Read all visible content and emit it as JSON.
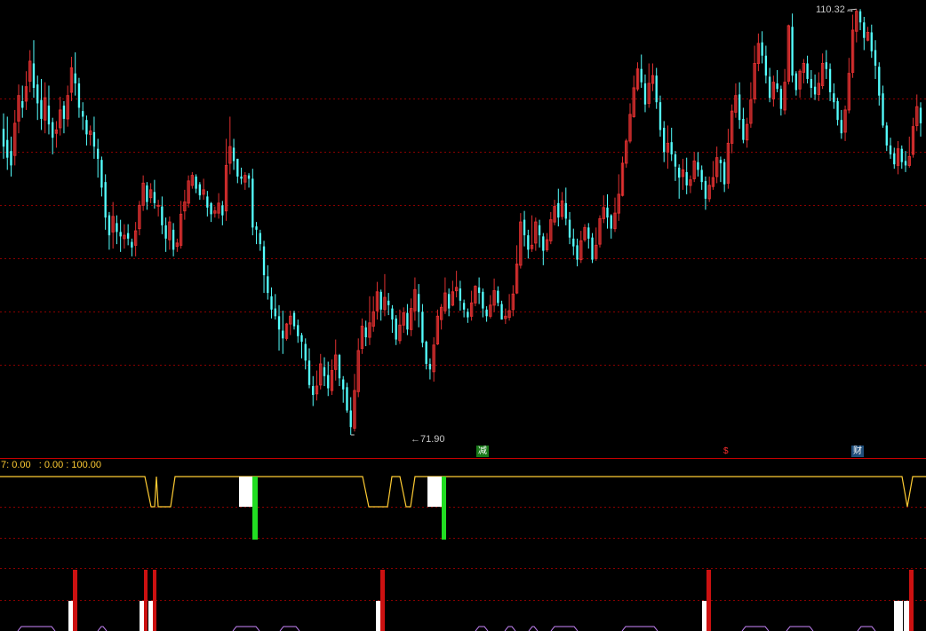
{
  "price_panel": {
    "high_label": "110.32",
    "low_label": "71.90",
    "price_min": 71.9,
    "price_max": 110.32,
    "gridline_prices": [
      102.2,
      97.4,
      92.6,
      87.8,
      83.0,
      78.2
    ],
    "up_color": "#e03030",
    "down_color": "#54ffff",
    "grid_color": "#8b0000",
    "candles": [
      [
        99.5,
        97.9,
        96.8,
        100.9
      ],
      [
        98.5,
        96.9,
        95.8,
        100.6
      ],
      [
        97.5,
        96.2,
        95.2,
        98.8
      ],
      [
        97.1,
        100.0,
        96.2,
        101.2
      ],
      [
        100.2,
        102.5,
        99.1,
        103.5
      ],
      [
        102.0,
        101.4,
        100.5,
        103.4
      ],
      [
        102.0,
        103.3,
        101.2,
        104.7
      ],
      [
        103.8,
        105.6,
        102.8,
        106.6
      ],
      [
        105.4,
        103.2,
        102.3,
        107.5
      ],
      [
        103.5,
        101.8,
        100.3,
        104.3
      ],
      [
        102.1,
        100.4,
        99.4,
        104.0
      ],
      [
        100.3,
        102.3,
        99.1,
        103.7
      ],
      [
        101.6,
        99.9,
        99.0,
        103.4
      ],
      [
        100.1,
        98.7,
        97.2,
        100.5
      ],
      [
        99.1,
        99.4,
        97.8,
        100.2
      ],
      [
        99.6,
        101.2,
        98.9,
        102.4
      ],
      [
        101.6,
        100.4,
        99.1,
        102.0
      ],
      [
        100.4,
        102.5,
        99.7,
        103.4
      ],
      [
        102.8,
        105.0,
        102.0,
        106.0
      ],
      [
        104.5,
        103.6,
        102.5,
        106.4
      ],
      [
        103.6,
        101.4,
        100.5,
        104.1
      ],
      [
        101.1,
        100.6,
        99.4,
        101.9
      ],
      [
        100.3,
        99.0,
        98.0,
        100.7
      ],
      [
        99.0,
        99.3,
        98.0,
        99.8
      ],
      [
        99.2,
        97.9,
        96.8,
        100.6
      ],
      [
        97.7,
        96.8,
        95.1,
        98.6
      ],
      [
        96.7,
        94.2,
        93.4,
        97.0
      ],
      [
        94.7,
        91.5,
        90.4,
        95.4
      ],
      [
        91.7,
        89.9,
        88.6,
        92.0
      ],
      [
        90.2,
        91.6,
        88.7,
        92.9
      ],
      [
        91.0,
        90.2,
        89.1,
        91.7
      ],
      [
        90.2,
        89.8,
        88.4,
        91.3
      ],
      [
        89.6,
        89.9,
        88.7,
        90.9
      ],
      [
        90.1,
        89.6,
        89.0,
        90.9
      ],
      [
        89.3,
        88.8,
        88.0,
        89.6
      ],
      [
        89.0,
        90.3,
        88.0,
        91.1
      ],
      [
        90.5,
        92.6,
        89.9,
        93.0
      ],
      [
        92.6,
        94.6,
        92.1,
        95.3
      ],
      [
        94.4,
        92.9,
        92.2,
        94.7
      ],
      [
        93.3,
        94.0,
        92.8,
        94.6
      ],
      [
        93.8,
        92.8,
        92.3,
        94.9
      ],
      [
        92.6,
        92.6,
        91.6,
        93.1
      ],
      [
        92.5,
        90.8,
        90.0,
        93.4
      ],
      [
        90.8,
        89.6,
        88.4,
        91.5
      ],
      [
        89.5,
        91.1,
        88.6,
        91.6
      ],
      [
        90.4,
        88.6,
        88.0,
        91.0
      ],
      [
        88.9,
        89.2,
        88.4,
        89.6
      ],
      [
        89.0,
        91.8,
        88.7,
        93.0
      ],
      [
        92.1,
        92.9,
        91.3,
        94.0
      ],
      [
        92.8,
        94.8,
        92.4,
        95.3
      ],
      [
        94.4,
        95.3,
        94.1,
        95.6
      ],
      [
        95.2,
        94.1,
        93.7,
        95.4
      ],
      [
        94.5,
        93.5,
        93.1,
        94.7
      ],
      [
        93.6,
        94.0,
        93.1,
        95.0
      ],
      [
        93.4,
        92.4,
        91.6,
        93.9
      ],
      [
        92.8,
        91.8,
        91.1,
        92.9
      ],
      [
        91.9,
        92.1,
        91.5,
        92.5
      ],
      [
        91.9,
        92.8,
        91.4,
        93.7
      ],
      [
        92.6,
        91.7,
        90.8,
        93.0
      ],
      [
        92.1,
        96.2,
        91.2,
        98.6
      ],
      [
        96.4,
        97.9,
        95.4,
        100.6
      ],
      [
        97.8,
        96.6,
        95.8,
        98.6
      ],
      [
        96.8,
        95.2,
        94.6,
        96.8
      ],
      [
        95.2,
        95.0,
        94.5,
        96.0
      ],
      [
        94.7,
        95.3,
        94.0,
        95.6
      ],
      [
        95.3,
        95.0,
        94.2,
        95.5
      ],
      [
        95.0,
        90.6,
        89.9,
        95.9
      ],
      [
        90.7,
        90.4,
        89.1,
        91.1
      ],
      [
        90.1,
        89.1,
        88.5,
        90.4
      ],
      [
        88.9,
        86.3,
        84.7,
        89.4
      ],
      [
        86.2,
        84.7,
        84.1,
        87.2
      ],
      [
        84.4,
        83.2,
        82.4,
        85.2
      ],
      [
        83.3,
        82.6,
        82.3,
        84.6
      ],
      [
        82.6,
        81.4,
        79.5,
        83.6
      ],
      [
        81.3,
        80.6,
        79.2,
        83.1
      ],
      [
        80.6,
        81.9,
        80.4,
        82.0
      ],
      [
        81.9,
        82.6,
        80.9,
        83.1
      ],
      [
        82.9,
        81.7,
        81.4,
        83.1
      ],
      [
        81.8,
        80.8,
        80.2,
        82.3
      ],
      [
        80.9,
        80.3,
        78.8,
        81.1
      ],
      [
        80.1,
        78.6,
        77.8,
        80.6
      ],
      [
        78.6,
        76.4,
        76.1,
        79.7
      ],
      [
        76.3,
        75.5,
        74.5,
        77.2
      ],
      [
        75.6,
        76.3,
        75.0,
        77.7
      ],
      [
        76.4,
        78.3,
        76.0,
        79.2
      ],
      [
        78.0,
        77.2,
        76.3,
        78.9
      ],
      [
        77.3,
        76.1,
        75.4,
        78.5
      ],
      [
        75.9,
        77.7,
        75.5,
        78.7
      ],
      [
        77.8,
        79.1,
        76.8,
        80.5
      ],
      [
        79.1,
        77.0,
        76.3,
        79.2
      ],
      [
        76.9,
        76.0,
        74.8,
        77.2
      ],
      [
        76.2,
        74.1,
        73.9,
        76.6
      ],
      [
        74.1,
        72.6,
        71.9,
        75.3
      ],
      [
        72.5,
        75.9,
        72.2,
        77.4
      ],
      [
        75.8,
        79.5,
        75.3,
        80.6
      ],
      [
        79.7,
        81.7,
        79.2,
        82.4
      ],
      [
        81.6,
        80.7,
        79.9,
        82.2
      ],
      [
        80.7,
        82.0,
        80.0,
        84.4
      ],
      [
        81.7,
        83.0,
        81.2,
        84.4
      ],
      [
        83.1,
        84.8,
        82.3,
        85.7
      ],
      [
        84.8,
        83.2,
        82.2,
        85.0
      ],
      [
        83.2,
        84.3,
        82.6,
        86.4
      ],
      [
        84.0,
        83.6,
        82.7,
        84.7
      ],
      [
        83.3,
        82.3,
        81.1,
        83.6
      ],
      [
        82.4,
        80.5,
        80.0,
        82.7
      ],
      [
        80.4,
        81.8,
        80.1,
        83.2
      ],
      [
        81.8,
        82.9,
        81.1,
        83.4
      ],
      [
        82.9,
        81.4,
        80.9,
        83.7
      ],
      [
        81.4,
        83.3,
        80.8,
        84.2
      ],
      [
        83.1,
        85.0,
        82.2,
        86.1
      ],
      [
        84.6,
        83.0,
        81.6,
        85.5
      ],
      [
        83.0,
        80.2,
        79.8,
        83.7
      ],
      [
        80.3,
        78.3,
        77.8,
        80.4
      ],
      [
        78.3,
        77.8,
        76.9,
        78.8
      ],
      [
        77.6,
        80.0,
        76.7,
        80.7
      ],
      [
        80.1,
        82.6,
        80.0,
        83.2
      ],
      [
        82.3,
        83.4,
        81.4,
        83.7
      ],
      [
        83.1,
        84.7,
        82.8,
        86.1
      ],
      [
        84.6,
        83.3,
        82.6,
        85.1
      ],
      [
        83.6,
        84.8,
        83.5,
        85.8
      ],
      [
        84.9,
        85.2,
        84.3,
        86.7
      ],
      [
        85.1,
        84.0,
        83.1,
        85.8
      ],
      [
        83.8,
        83.2,
        82.5,
        84.1
      ],
      [
        83.0,
        82.5,
        82.0,
        83.3
      ],
      [
        82.6,
        83.8,
        82.2,
        84.9
      ],
      [
        83.8,
        85.3,
        83.5,
        85.4
      ],
      [
        85.2,
        84.7,
        83.7,
        86.1
      ],
      [
        84.8,
        83.3,
        82.5,
        85.1
      ],
      [
        83.2,
        82.6,
        82.1,
        83.5
      ],
      [
        82.6,
        83.6,
        82.4,
        84.5
      ],
      [
        83.6,
        84.9,
        83.0,
        86.0
      ],
      [
        84.9,
        83.8,
        83.5,
        85.3
      ],
      [
        83.7,
        82.3,
        82.3,
        84.0
      ],
      [
        82.4,
        82.6,
        81.9,
        83.3
      ],
      [
        82.5,
        83.1,
        82.2,
        84.6
      ],
      [
        83.2,
        84.6,
        82.6,
        85.4
      ],
      [
        84.7,
        87.3,
        84.6,
        89.0
      ],
      [
        87.2,
        91.1,
        86.9,
        91.9
      ],
      [
        91.3,
        89.9,
        88.9,
        92.1
      ],
      [
        89.9,
        88.6,
        87.8,
        90.4
      ],
      [
        88.7,
        89.0,
        88.4,
        91.7
      ],
      [
        89.2,
        91.1,
        88.5,
        91.5
      ],
      [
        90.8,
        89.9,
        88.8,
        91.3
      ],
      [
        89.8,
        88.5,
        87.2,
        90.1
      ],
      [
        88.6,
        89.5,
        88.4,
        90.1
      ],
      [
        89.4,
        91.3,
        89.1,
        92.0
      ],
      [
        91.1,
        92.5,
        90.8,
        93.1
      ],
      [
        92.8,
        91.5,
        90.7,
        94.1
      ],
      [
        91.6,
        93.0,
        91.3,
        93.8
      ],
      [
        92.8,
        91.4,
        90.8,
        94.2
      ],
      [
        91.3,
        89.7,
        89.1,
        92.0
      ],
      [
        89.6,
        88.9,
        88.1,
        90.5
      ],
      [
        89.0,
        87.7,
        87.1,
        89.6
      ],
      [
        87.7,
        89.4,
        87.4,
        90.3
      ],
      [
        89.5,
        90.6,
        89.3,
        90.9
      ],
      [
        90.6,
        89.6,
        88.7,
        91.0
      ],
      [
        89.7,
        87.7,
        87.4,
        90.1
      ],
      [
        87.8,
        89.0,
        87.6,
        90.6
      ],
      [
        89.1,
        91.4,
        88.8,
        91.7
      ],
      [
        91.4,
        92.4,
        91.0,
        93.5
      ],
      [
        92.4,
        91.5,
        90.5,
        93.6
      ],
      [
        91.7,
        90.5,
        89.6,
        91.8
      ],
      [
        90.5,
        91.9,
        90.2,
        93.3
      ],
      [
        91.9,
        93.6,
        91.2,
        95.4
      ],
      [
        93.5,
        96.4,
        93.4,
        97.0
      ],
      [
        96.4,
        98.4,
        96.0,
        98.6
      ],
      [
        98.4,
        100.8,
        98.2,
        101.8
      ],
      [
        100.6,
        103.2,
        100.5,
        104.3
      ],
      [
        103.1,
        104.9,
        102.9,
        105.5
      ],
      [
        104.9,
        103.7,
        103.2,
        106.2
      ],
      [
        103.6,
        101.7,
        101.0,
        104.4
      ],
      [
        101.8,
        103.6,
        101.4,
        105.4
      ],
      [
        103.6,
        104.3,
        102.9,
        105.4
      ],
      [
        104.3,
        101.9,
        101.3,
        105.0
      ],
      [
        101.9,
        99.4,
        98.8,
        102.5
      ],
      [
        99.6,
        97.4,
        96.5,
        100.2
      ],
      [
        97.4,
        98.2,
        95.9,
        99.8
      ],
      [
        98.3,
        97.2,
        96.6,
        99.6
      ],
      [
        97.2,
        96.1,
        94.8,
        97.5
      ],
      [
        96.0,
        95.1,
        93.2,
        96.3
      ],
      [
        95.2,
        95.8,
        94.0,
        96.8
      ],
      [
        95.6,
        94.4,
        93.6,
        96.9
      ],
      [
        94.4,
        94.9,
        93.7,
        95.3
      ],
      [
        95.0,
        96.6,
        94.7,
        97.4
      ],
      [
        96.5,
        95.8,
        95.2,
        97.4
      ],
      [
        95.8,
        94.7,
        94.0,
        96.2
      ],
      [
        94.8,
        93.2,
        92.2,
        95.2
      ],
      [
        93.2,
        94.4,
        92.9,
        95.2
      ],
      [
        94.3,
        95.1,
        94.0,
        96.6
      ],
      [
        95.2,
        96.9,
        94.6,
        97.9
      ],
      [
        96.7,
        96.4,
        94.7,
        97.0
      ],
      [
        96.5,
        94.5,
        93.8,
        96.8
      ],
      [
        94.6,
        98.2,
        94.1,
        99.5
      ],
      [
        98.2,
        101.1,
        97.3,
        101.7
      ],
      [
        101.0,
        102.5,
        100.5,
        103.6
      ],
      [
        102.6,
        100.3,
        99.5,
        103.7
      ],
      [
        100.4,
        98.5,
        98.2,
        101.4
      ],
      [
        98.5,
        99.9,
        97.8,
        100.5
      ],
      [
        100.0,
        102.1,
        99.6,
        103.7
      ],
      [
        102.2,
        105.4,
        101.8,
        107.0
      ],
      [
        105.4,
        107.2,
        104.7,
        108.1
      ],
      [
        107.3,
        106.1,
        105.4,
        108.3
      ],
      [
        106.1,
        104.3,
        103.6,
        107.0
      ],
      [
        104.2,
        102.3,
        101.9,
        105.0
      ],
      [
        102.2,
        103.7,
        101.5,
        104.3
      ],
      [
        103.6,
        103.1,
        102.8,
        104.8
      ],
      [
        103.1,
        101.3,
        100.7,
        103.4
      ],
      [
        101.2,
        103.7,
        100.8,
        104.9
      ],
      [
        103.8,
        108.8,
        103.5,
        108.9
      ],
      [
        108.7,
        104.3,
        103.7,
        109.9
      ],
      [
        104.5,
        103.0,
        102.5,
        104.7
      ],
      [
        103.1,
        104.7,
        102.3,
        104.9
      ],
      [
        104.6,
        105.4,
        103.6,
        105.8
      ],
      [
        105.4,
        104.0,
        103.6,
        106.1
      ],
      [
        104.0,
        103.2,
        102.3,
        104.8
      ],
      [
        103.3,
        102.6,
        102.1,
        104.4
      ],
      [
        102.6,
        103.6,
        102.0,
        104.6
      ],
      [
        103.4,
        105.4,
        103.1,
        106.3
      ],
      [
        105.5,
        104.9,
        104.0,
        106.6
      ],
      [
        104.9,
        102.8,
        102.0,
        105.4
      ],
      [
        102.7,
        101.9,
        101.3,
        103.6
      ],
      [
        102.0,
        100.3,
        99.8,
        102.3
      ],
      [
        100.3,
        99.1,
        98.6,
        101.2
      ],
      [
        99.2,
        101.2,
        98.4,
        101.6
      ],
      [
        101.2,
        104.5,
        100.9,
        105.9
      ],
      [
        104.6,
        108.4,
        104.1,
        109.8
      ],
      [
        108.3,
        110.1,
        107.3,
        110.3
      ],
      [
        110.1,
        109.1,
        108.4,
        110.3
      ],
      [
        109.1,
        107.7,
        106.6,
        109.6
      ],
      [
        107.5,
        108.2,
        107.4,
        108.7
      ],
      [
        108.2,
        106.5,
        105.9,
        108.9
      ],
      [
        106.6,
        105.2,
        104.0,
        107.5
      ],
      [
        105.1,
        102.5,
        101.6,
        105.5
      ],
      [
        102.7,
        99.8,
        99.6,
        103.4
      ],
      [
        99.8,
        98.0,
        97.5,
        100.1
      ],
      [
        98.0,
        97.2,
        96.8,
        98.7
      ],
      [
        97.3,
        96.3,
        95.9,
        97.8
      ],
      [
        96.2,
        97.7,
        95.4,
        98.4
      ],
      [
        97.7,
        96.5,
        95.9,
        98.0
      ],
      [
        96.6,
        96.2,
        95.6,
        97.5
      ],
      [
        96.2,
        97.0,
        96.0,
        98.8
      ],
      [
        97.2,
        99.7,
        96.9,
        100.5
      ],
      [
        99.8,
        101.5,
        99.3,
        102.6
      ],
      [
        101.4,
        100.0,
        98.8,
        101.9
      ]
    ]
  },
  "indicator_bar": {
    "info_text_a": "7: 0.00",
    "info_text_b": ": 0.00 : 100.00",
    "badges": [
      {
        "text": "减",
        "color": "#ffffff",
        "bg": "#1a7a1a"
      },
      {
        "text": "$",
        "color": "#ff3030",
        "bg": "transparent"
      },
      {
        "text": "财",
        "color": "#ffffff",
        "bg": "#1f4e7a"
      }
    ],
    "line_color": "#ffcc33",
    "divider_color": "#cc0000"
  },
  "lower_panels": {
    "green_color": "#22dd22",
    "red_color": "#cc1111",
    "white_color": "#ffffff",
    "violet_color": "#cc88ff"
  }
}
